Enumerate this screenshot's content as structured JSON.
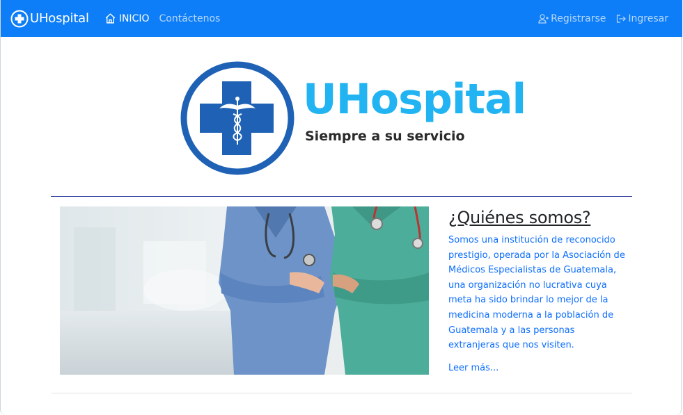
{
  "navbar": {
    "brand": "UHospital",
    "home_label": "INICIO",
    "contact_label": "Contáctenos",
    "register_label": "Registrarse",
    "login_label": "Ingresar",
    "color": "#0d7ef7"
  },
  "logo": {
    "title": "UHospital",
    "subtitle": "Siempre a su servicio",
    "accent": "#22b4f2",
    "cross_color": "#1f62b5"
  },
  "about": {
    "title": "¿Quiénes somos?",
    "body": "Somos una institución de reconocido prestigio, operada por la Asociación de Médicos Especialistas de Guatemala, una organización no lucrativa cuya meta ha sido brindar lo mejor de la medicina moderna a la población de Guatemala y a las personas extranjeras que nos visiten.",
    "read_more": "Leer más..."
  }
}
